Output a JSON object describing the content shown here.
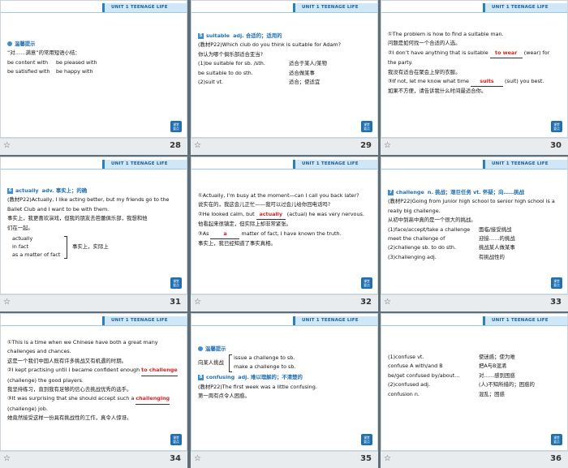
{
  "banner_text": "UNIT 1  TEENAGE LIFE",
  "logo_text": "课堂\n要点",
  "slides": [
    {
      "page": "28",
      "tip_title": "温馨提示",
      "l1": "“对……满意”的常用短语小结：",
      "c1": [
        "be content with",
        "be satisfied with"
      ],
      "c2": [
        "be pleased with",
        "be happy with"
      ]
    },
    {
      "page": "29",
      "num": "5",
      "word": "suitable",
      "pos_def": "adj. 合适的；适用的",
      "ex_en": "(教材P22)Which club do you think is suitable for Adam?",
      "ex_cn": "你认为哪个俱乐部适合亚当?",
      "rows": [
        {
          "a": "(1)be suitable for sb. /sth.",
          "b": "适合于某人/某物"
        },
        {
          "a": "be suitable to do sth.",
          "b": "适合做某事"
        },
        {
          "a": "(2)suit vt.",
          "b": "适合；使适宜"
        }
      ]
    },
    {
      "page": "30",
      "l1": "①The problem is how to find a suitable man.",
      "l2": "问题是如何找一个合适的人选。",
      "l3a": "②I don’t have anything that is suitable",
      "ans1": "to wear",
      "l3b": "(wear) for",
      "l4": "the party.",
      "l5": "我没有适合在聚会上穿的衣服。",
      "l6a": "③If not, let me know what time",
      "ans2": "suits",
      "l6b": "(suit) you best.",
      "l7": "如果不方便，请告诉我什么时间最适合你。"
    },
    {
      "page": "31",
      "num": "6",
      "word": "actually",
      "pos_def": "adv. 事实上；的确",
      "ex1": "(教材P22)Actually, I like acting better, but my friends go to the",
      "ex2": "Ballet Club and I want to be with them.",
      "cn1": "事实上，我更喜欢演戏，但我的朋友去芭蕾俱乐部，我想和他",
      "cn2": "们在一起。",
      "list": [
        "actually",
        "in fact",
        "as a matter of fact"
      ],
      "meaning": "事实上，实际上"
    },
    {
      "page": "32",
      "l1": "①Actually, I’m busy at the moment—can I call you back later?",
      "l2": "说实在的，我这会儿正忙——我可以过会儿给你回电话吗?",
      "l3a": "②He looked calm, but",
      "ans1": "actually",
      "l3b": "(actual) he was very nervous.",
      "l4": "他看起来很镇定，但实际上却非常紧张。",
      "l5a": "③As",
      "ans2": "a",
      "l5b": "matter of fact, I have known the truth.",
      "l6": "事实上，我已经知道了事实真相。"
    },
    {
      "page": "33",
      "num": "7",
      "word": "challenge",
      "pos_def": "n. 挑战；艰巨任务  vt. 怀疑；向……挑战",
      "ex1": "(教材P22)Going from junior high school to senior high school is a",
      "ex2": "really big challenge.",
      "cn1": "从初中到高中真的是一个很大的挑战。",
      "rows": [
        {
          "a": "(1)face/accept/take a challenge",
          "b": "面临/接受挑战"
        },
        {
          "a": "meet the challenge of",
          "b": "迎接……的挑战"
        },
        {
          "a": "(2)challenge sb. to do sth.",
          "b": "挑战某人做某事"
        },
        {
          "a": "(3)challenging adj.",
          "b": "有挑战性的"
        }
      ]
    },
    {
      "page": "34",
      "l1": "①This is a time when we Chinese have both a great many",
      "l2": "challenges and chances.",
      "l3": "这是一个我们中国人既有许多挑战又有机遇的时期。",
      "l4a": "②I kept practising until I became confident enough",
      "ans1": "to challenge",
      "l5": "(challenge) the good players.",
      "l6": "我坚持练习，直到我有足够的信心去挑战优秀的选手。",
      "l7a": "③It was surprising that she should accept such a",
      "ans2": "challenging",
      "l8": "(challenge) job.",
      "l9": "她竟然接受这样一份具有挑战性的工作，真令人惊讶。"
    },
    {
      "page": "35",
      "tip_title": "温馨提示",
      "pre": "向某人挑战",
      "opt1a": "issue",
      "opt1b": "a challenge to sb.",
      "opt2a": "make",
      "opt2b": "a challenge to sb.",
      "num": "8",
      "word": "confusing",
      "pos_def": "adj. 难以理解的；不清楚的",
      "ex1": "(教材P22)The first week was a little confusing.",
      "cn1": "第一周有点令人困惑。"
    },
    {
      "page": "36",
      "rows": [
        {
          "a": "(1)confuse vt.",
          "b": "使迷惑；使为难"
        },
        {
          "a": "confuse A with/and B",
          "b": "把A与B混淆"
        },
        {
          "a": "be/get confused by/about…",
          "b": "对……感到困惑"
        },
        {
          "a": "(2)confused adj.",
          "b": "(人)不知所措的；困惑的"
        },
        {
          "a": "confusion n.",
          "b": "混乱；困惑"
        }
      ]
    }
  ]
}
